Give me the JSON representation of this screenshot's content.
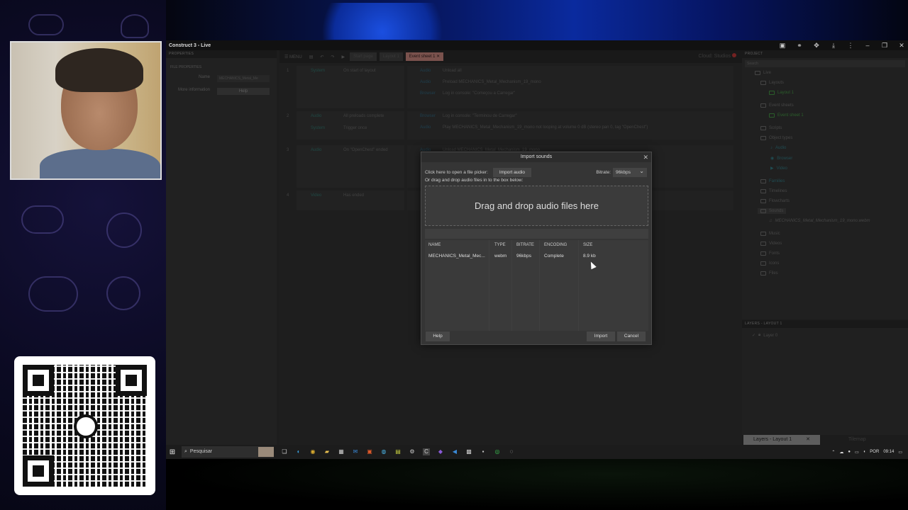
{
  "app": {
    "title": "Construct 3 - Live",
    "title_icons": [
      "document-icon",
      "link-icon",
      "addon-icon",
      "download-icon",
      "more-icon",
      "minimize-icon",
      "maximize-icon",
      "close-icon"
    ]
  },
  "properties": {
    "header": "PROPERTIES",
    "section": "FILE PROPERTIES",
    "name_label": "Name",
    "name_value": "MECHANICS_Metal_Me",
    "more_info_label": "More information",
    "help_button": "Help"
  },
  "toolbar": {
    "menu_label": "MENU",
    "tabs": [
      "Start page",
      "Layout 1",
      "Event sheet 1"
    ],
    "active_tab": "Event sheet 1",
    "cloud_label": "Cloud: Studios"
  },
  "events": [
    {
      "num": "1",
      "conditions": [
        {
          "object": "System",
          "text": "On start of layout"
        }
      ],
      "actions": [
        {
          "object": "Audio",
          "text": "Unload all"
        },
        {
          "object": "Audio",
          "text": "Preload MECHANICS_Metal_Mechanism_19_mono"
        },
        {
          "object": "Browser",
          "text": "Log in console: \"Começou a Carregar\""
        }
      ]
    },
    {
      "num": "2",
      "conditions": [
        {
          "object": "Audio",
          "text": "All preloads complete"
        },
        {
          "object": "System",
          "text": "Trigger once"
        }
      ],
      "actions": [
        {
          "object": "Browser",
          "text": "Log in console: \"Terminou de Carregar\""
        },
        {
          "object": "Audio",
          "text": "Play MECHANICS_Metal_Mechanism_19_mono not looping at volume 0 dB (stereo pan 0, tag \"OpenChest\")"
        }
      ]
    },
    {
      "num": "3",
      "conditions": [
        {
          "object": "Audio",
          "text": "On \"OpenChest\" ended"
        }
      ],
      "actions": [
        {
          "object": "Audio",
          "text": "Unload MECHANICS_Metal_Mechanism_19_mono"
        }
      ]
    },
    {
      "num": "4",
      "conditions": [
        {
          "object": "Video",
          "text": "Has ended"
        }
      ],
      "actions": []
    }
  ],
  "project": {
    "header": "PROJECT",
    "search_placeholder": "Search",
    "tree": [
      {
        "label": "Live",
        "kind": "folder"
      },
      {
        "label": "Layouts",
        "kind": "folder"
      },
      {
        "label": "Layout 1",
        "kind": "layout"
      },
      {
        "label": "Event sheets",
        "kind": "folder"
      },
      {
        "label": "Event sheet 1",
        "kind": "sheet"
      },
      {
        "label": "Scripts",
        "kind": "folder"
      },
      {
        "label": "Object types",
        "kind": "folder"
      },
      {
        "label": "Audio",
        "kind": "object"
      },
      {
        "label": "Browser",
        "kind": "object"
      },
      {
        "label": "Video",
        "kind": "object"
      },
      {
        "label": "Families",
        "kind": "folder"
      },
      {
        "label": "Timelines",
        "kind": "folder"
      },
      {
        "label": "Flowcharts",
        "kind": "folder"
      },
      {
        "label": "Sounds",
        "kind": "folder"
      },
      {
        "label": "MECHANICS_Metal_Mechanism_19_mono.webm",
        "kind": "file"
      },
      {
        "label": "Music",
        "kind": "folder"
      },
      {
        "label": "Videos",
        "kind": "folder"
      },
      {
        "label": "Fonts",
        "kind": "folder"
      },
      {
        "label": "Icons",
        "kind": "folder"
      },
      {
        "label": "Files",
        "kind": "folder"
      }
    ]
  },
  "layers": {
    "header": "LAYERS - LAYOUT 1",
    "items": [
      "Layer 0"
    ],
    "tab_label": "Layers - Layout 1",
    "tilemap_label": "Tilemap"
  },
  "dialog": {
    "title": "Import sounds",
    "picker_text": "Click here to open a file picker:",
    "import_audio_button": "Import audio",
    "bitrate_label": "Bitrate:",
    "bitrate_value": "96kbps",
    "drag_hint": "Or drag and drop audio files in to the box below:",
    "dropzone_text": "Drag and drop audio files here",
    "columns": [
      "NAME",
      "TYPE",
      "BITRATE",
      "ENCODING",
      "SIZE"
    ],
    "rows": [
      {
        "name": "MECHANICS_Metal_Mec...",
        "type": "webm",
        "bitrate": "96kbps",
        "encoding": "Complete",
        "size": "8.9 kb"
      }
    ],
    "help_button": "Help",
    "import_button": "Import",
    "cancel_button": "Cancel"
  },
  "taskbar": {
    "search_placeholder": "Pesquisar",
    "language": "POR",
    "time": "09:14"
  }
}
